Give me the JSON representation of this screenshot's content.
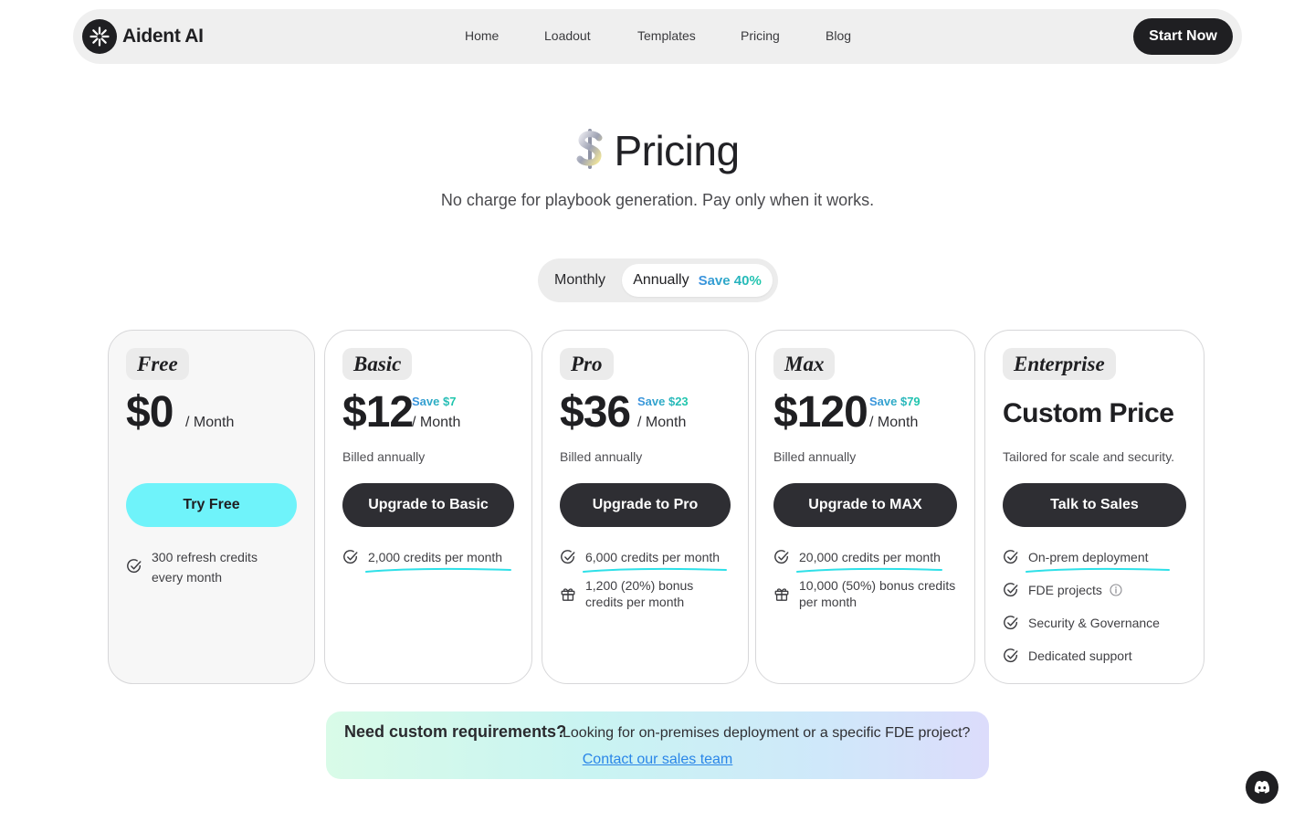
{
  "nav": {
    "brand": "Aident AI",
    "links": [
      "Home",
      "Loadout",
      "Templates",
      "Pricing",
      "Blog"
    ],
    "cta": "Start Now"
  },
  "hero": {
    "title": "Pricing",
    "subtitle": "No charge for playbook generation. Pay only when it works."
  },
  "billing_toggle": {
    "monthly": "Monthly",
    "annually": "Annually",
    "save": "Save 40%",
    "selected": "Annually"
  },
  "plans": {
    "free": {
      "name": "Free",
      "price": "$0",
      "per": "/ Month",
      "cta": "Try Free",
      "features": [
        "300 refresh credits every month"
      ]
    },
    "basic": {
      "name": "Basic",
      "price": "$12",
      "save": "Save $7",
      "per": "/ Month",
      "billed": "Billed annually",
      "cta": "Upgrade to Basic",
      "features": [
        "2,000 credits per month"
      ]
    },
    "pro": {
      "name": "Pro",
      "price": "$36",
      "save": "Save $23",
      "per": "/ Month",
      "billed": "Billed annually",
      "cta": "Upgrade to Pro",
      "features": [
        "6,000 credits per month",
        "1,200 (20%) bonus credits per month"
      ]
    },
    "max": {
      "name": "Max",
      "price": "$120",
      "save": "Save $79",
      "per": "/ Month",
      "billed": "Billed annually",
      "cta": "Upgrade to MAX",
      "features": [
        "20,000 credits per month",
        "10,000 (50%) bonus credits per month"
      ]
    },
    "enterprise": {
      "name": "Enterprise",
      "price": "Custom Price",
      "billed": "Tailored for scale and security.",
      "cta": "Talk to Sales",
      "features": [
        "On-prem deployment",
        "FDE projects",
        "Security & Governance",
        "Dedicated support"
      ]
    }
  },
  "contact": {
    "question": "Need custom requirements?",
    "description": "Looking for on-premises deployment or a specific FDE project?",
    "link": "Contact our sales team"
  },
  "colors": {
    "dark": "#1f1f22",
    "button_dark": "#2e2e33",
    "cyan_button": "#6ff3fa",
    "save_gradient_start": "#3b8fe0",
    "save_gradient_end": "#1dc9a9",
    "underline": "#2ee0e8",
    "link": "#2a86e8"
  },
  "icons": {
    "brand": "sparkle-logo-icon",
    "hero": "dollar-sign-icon",
    "check": "check-circle-icon",
    "bonus": "gift-icon",
    "info": "info-icon",
    "chat": "discord-icon"
  }
}
